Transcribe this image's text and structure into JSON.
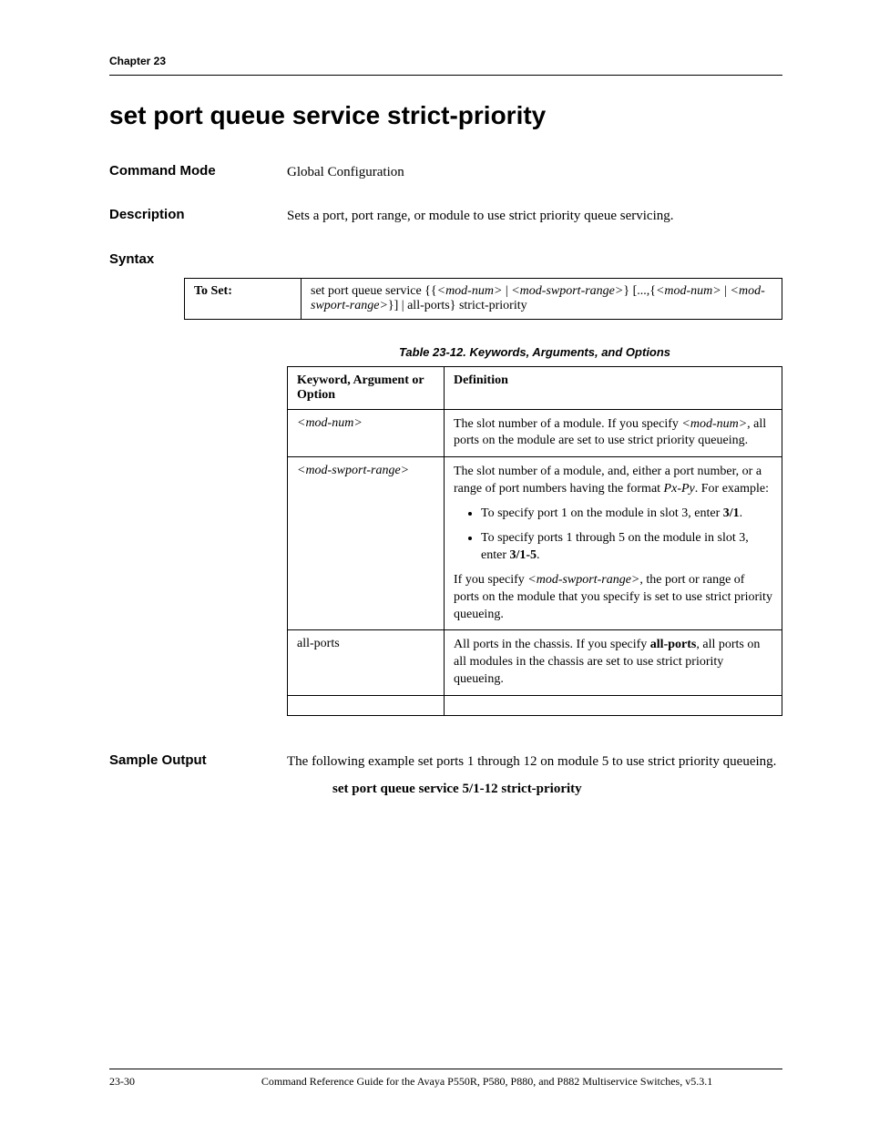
{
  "header": {
    "chapter": "Chapter 23"
  },
  "title": "set port queue service strict-priority",
  "command_mode": {
    "label": "Command Mode",
    "value": "Global Configuration"
  },
  "description": {
    "label": "Description",
    "value": "Sets a port, port range, or module to use strict priority queue servicing."
  },
  "syntax": {
    "label": "Syntax",
    "to_set_label": "To Set:",
    "to_set_value_html": "set port queue service {{<em>&lt;mod-num&gt;</em> | <em>&lt;mod-swport-range&gt;</em>} [...,{<em>&lt;mod-num&gt;</em> | <em>&lt;mod-swport-range&gt;</em>}] | all-ports} strict-priority"
  },
  "table": {
    "caption": "Table 23-12.  Keywords, Arguments, and Options",
    "header_kw": "Keyword, Argument or Option",
    "header_def": "Definition",
    "rows": [
      {
        "kw_html": "&lt;mod-num&gt;",
        "kw_italic": true,
        "def_html": "The slot number of a module. If you specify <em>&lt;mod-num&gt;</em>, all ports on the module are set to use strict priority queueing."
      },
      {
        "kw_html": "&lt;mod-swport-range&gt;",
        "kw_italic": true,
        "def_html": "The slot number of a module, and, either a port number, or a range of port numbers having the format <em>Px-Py</em>. For example:<ul><li>To specify port 1 on the module in slot 3, enter <strong>3/1</strong>.</li><li>To specify ports 1 through 5 on the module in slot 3, enter <strong>3/1-5</strong>.</li></ul>If you specify <em>&lt;mod-swport-range&gt;</em>, the port or range of ports on the module that you specify is set to use strict priority queueing."
      },
      {
        "kw_html": "all-ports",
        "kw_italic": false,
        "def_html": "All ports in the chassis. If you specify <strong>all-ports</strong>, all ports on all modules in the chassis are set to use strict priority queueing."
      }
    ]
  },
  "sample_output": {
    "label": "Sample Output",
    "text": "The following example set ports 1 through 12 on module 5 to use strict priority queueing.",
    "command": "set port queue service 5/1-12 strict-priority"
  },
  "footer": {
    "page": "23-30",
    "text": "Command Reference Guide for the Avaya P550R, P580, P880, and P882 Multiservice Switches, v5.3.1"
  }
}
